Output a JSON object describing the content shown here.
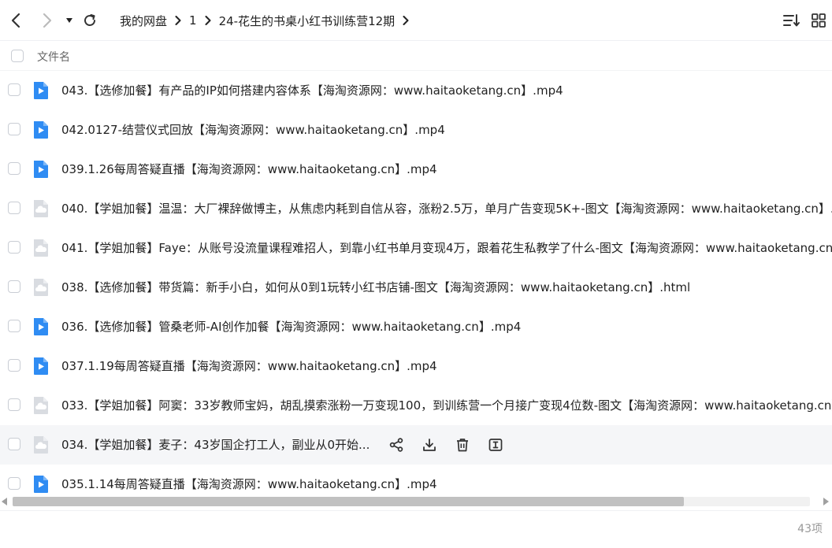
{
  "breadcrumb": {
    "items": [
      "我的网盘",
      "1",
      "24-花生的书桌小红书训练营12期"
    ]
  },
  "table": {
    "header_label": "文件名"
  },
  "files": [
    {
      "name": "043.【选修加餐】有产品的IP如何搭建内容体系【海淘资源网：www.haitaoketang.cn】.mp4",
      "type": "video"
    },
    {
      "name": "042.0127-结营仪式回放【海淘资源网：www.haitaoketang.cn】.mp4",
      "type": "video"
    },
    {
      "name": "039.1.26每周答疑直播【海淘资源网：www.haitaoketang.cn】.mp4",
      "type": "video"
    },
    {
      "name": "040.【学姐加餐】温温：大厂裸辞做博主，从焦虑内耗到自信从容，涨粉2.5万，单月广告变现5K+-图文【海淘资源网：www.haitaoketang.cn】.l",
      "type": "web"
    },
    {
      "name": "041.【学姐加餐】Faye：从账号没流量课程难招人，到靠小红书单月变现4万，跟着花生私教学了什么-图文【海淘资源网：www.haitaoketang.cn",
      "type": "web"
    },
    {
      "name": "038.【选修加餐】带货篇：新手小白，如何从0到1玩转小红书店铺-图文【海淘资源网：www.haitaoketang.cn】.html",
      "type": "web"
    },
    {
      "name": "036.【选修加餐】管桑老师-AI创作加餐【海淘资源网：www.haitaoketang.cn】.mp4",
      "type": "video"
    },
    {
      "name": "037.1.19每周答疑直播【海淘资源网：www.haitaoketang.cn】.mp4",
      "type": "video"
    },
    {
      "name": "033.【学姐加餐】阿窦：33岁教师宝妈，胡乱摸索涨粉一万变现100，到训练营一个月接广变现4位数-图文【海淘资源网：www.haitaoketang.cn】",
      "type": "web"
    },
    {
      "name": "034.【学姐加餐】麦子：43岁国企打工人，副业从0开始...",
      "type": "web",
      "hover": true
    },
    {
      "name": "035.1.14每周答疑直播【海淘资源网：www.haitaoketang.cn】.mp4",
      "type": "video"
    }
  ],
  "footer": {
    "count": "43项"
  },
  "colors": {
    "video_icon": "#2f8cf3",
    "web_icon": "#d9dce1",
    "hover_row": "#f5f6f8"
  },
  "icons": {
    "back": "arrow-left-icon",
    "forward": "arrow-right-icon",
    "history": "caret-down-icon",
    "refresh": "refresh-icon",
    "sort": "sort-icon",
    "grid": "grid-view-icon",
    "share": "share-icon",
    "download": "download-icon",
    "delete": "trash-icon",
    "rename": "rename-icon"
  }
}
